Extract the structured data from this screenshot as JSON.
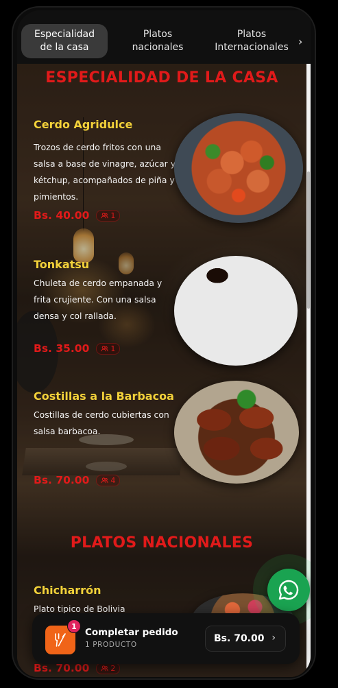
{
  "tabs": [
    {
      "label": "Especialidad\nde la casa",
      "active": true
    },
    {
      "label": "Platos\nnacionales",
      "active": false
    },
    {
      "label": "Platos\nInternacionales",
      "active": false
    }
  ],
  "sections": [
    {
      "title": "ESPECIALIDAD DE LA CASA"
    },
    {
      "title": "PLATOS NACIONALES"
    }
  ],
  "items": [
    {
      "name": "Cerdo Agridulce",
      "description": "Trozos de cerdo fritos con una salsa a base de vinagre, azúcar y kétchup, acompañados de piña y pimientos.",
      "price": "Bs. 40.00",
      "servings": "1"
    },
    {
      "name": "Tonkatsu",
      "description": "Chuleta de cerdo empanada y frita crujiente. Con una salsa densa y col rallada.",
      "price": "Bs. 35.00",
      "servings": "1"
    },
    {
      "name": "Costillas a la Barbacoa",
      "description": "Costillas de cerdo cubiertas con salsa barbacoa.",
      "price": "Bs. 70.00",
      "servings": "4"
    },
    {
      "name": "Chicharrón",
      "description": "Plato tipico de Bolivia",
      "price": "Bs. 70.00",
      "servings": "2"
    }
  ],
  "order": {
    "count": "1",
    "title": "Completar pedido",
    "subtitle": "1 PRODUCTO",
    "total": "Bs. 70.00"
  },
  "colors": {
    "accent_red": "#e11a1a",
    "item_title_yellow": "#f3d23a",
    "order_orange": "#f06418",
    "whatsapp_green": "#1aa351"
  },
  "icons": {
    "tabs_next": "chevron-right-icon",
    "servings": "people-icon",
    "order": "utensils-icon",
    "whatsapp": "whatsapp-icon"
  }
}
